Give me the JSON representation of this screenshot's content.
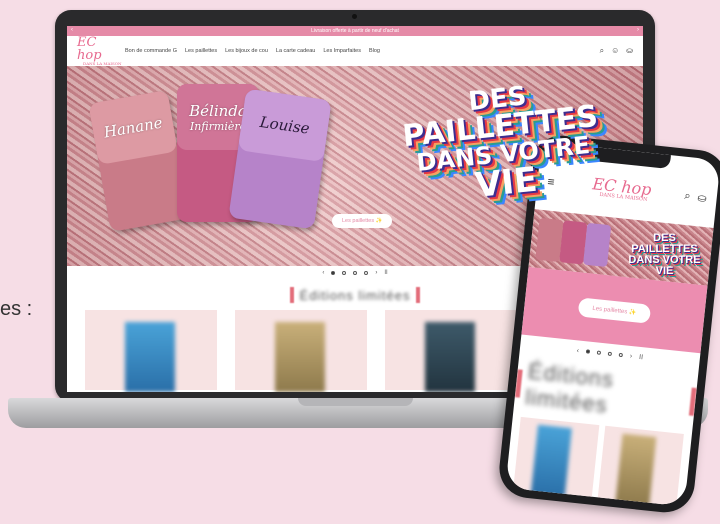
{
  "edge_text": "es :",
  "desktop": {
    "announcement": "Livraison offerte à partir de neuf d'achat",
    "logo": {
      "main": "EC hop",
      "sub": "DANS LA MAISON"
    },
    "nav": [
      "Bon de commande G",
      "Les paillettes",
      "Les bijoux de cou",
      "La carte cadeau",
      "Les Imparfaites",
      "Blog"
    ],
    "icons": [
      "search-icon",
      "account-icon",
      "cart-icon"
    ],
    "hero": {
      "pots": [
        {
          "name": "Hanane",
          "sub": ""
        },
        {
          "name": "Bélinda",
          "sub": "Infirmière"
        },
        {
          "name": "Louise",
          "sub": ""
        }
      ],
      "slogan": [
        "DES",
        "PAILLETTES",
        "DANS VOTRE",
        "VIE"
      ],
      "button": "Les paillettes ✨"
    },
    "carousel": {
      "prev": "‹",
      "next": "›",
      "pause": "II"
    },
    "section_title": "Éditions limitées"
  },
  "mobile": {
    "logo": {
      "main": "EC hop",
      "sub": "DANS LA MAISON"
    },
    "menu_icon": "≡",
    "hero_slogan": [
      "DES",
      "PAILLETTES",
      "DANS VOTRE",
      "VIE"
    ],
    "button": "Les paillettes ✨",
    "carousel": {
      "prev": "‹",
      "next": "›",
      "pause": "II"
    },
    "section_title": "Éditions limitées"
  },
  "colors": {
    "brand_pink": "#e76a8f",
    "announce": "#e58aa7",
    "mobile_band": "#ec8db0"
  }
}
